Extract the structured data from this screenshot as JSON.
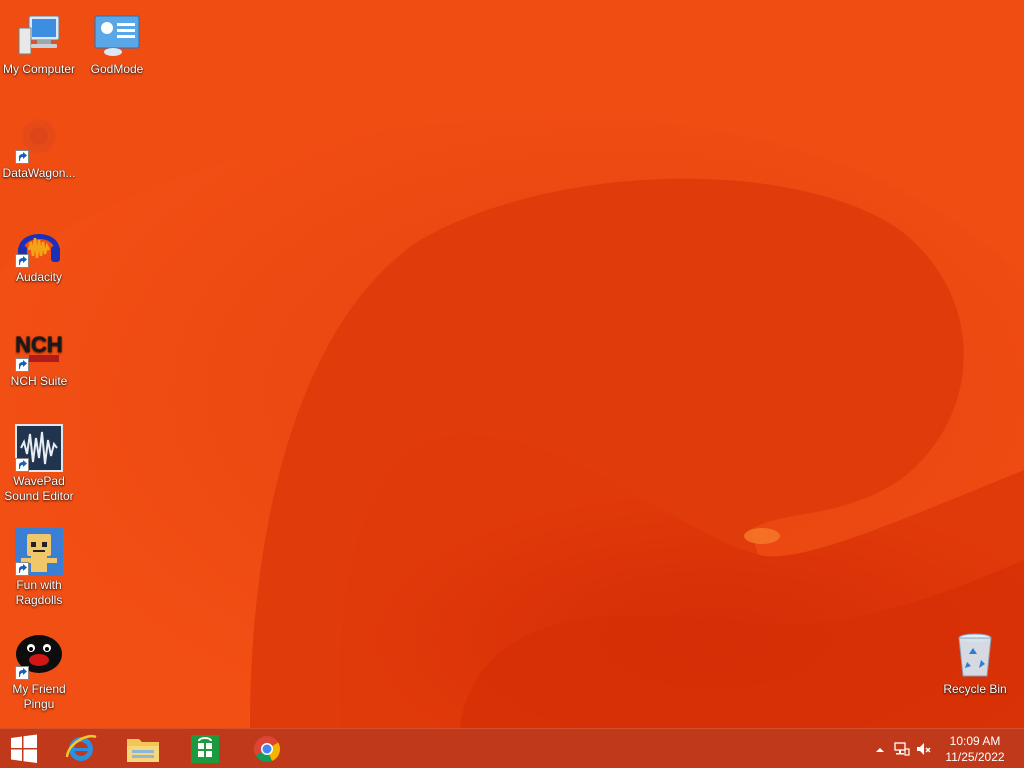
{
  "desktop": {
    "icons": [
      {
        "label": "My Computer",
        "icon": "computer-icon",
        "shortcut": false
      },
      {
        "label": "GodMode",
        "icon": "control-panel-icon",
        "shortcut": false
      },
      {
        "label": "DataWagon...",
        "icon": "datawagon-icon",
        "shortcut": true
      },
      {
        "label": "Audacity",
        "icon": "audacity-icon",
        "shortcut": true
      },
      {
        "label": "NCH Suite",
        "icon": "nch-icon",
        "shortcut": true
      },
      {
        "label": "WavePad Sound Editor",
        "line1": "WavePad",
        "line2": "Sound Editor",
        "icon": "wavepad-icon",
        "shortcut": true
      },
      {
        "label": "Fun with Ragdolls",
        "line1": "Fun with",
        "line2": "Ragdolls",
        "icon": "ragdolls-icon",
        "shortcut": true
      },
      {
        "label": "My Friend Pingu",
        "line1": "My Friend",
        "line2": "Pingu",
        "icon": "pingu-icon",
        "shortcut": true
      },
      {
        "label": "Recycle Bin",
        "icon": "recycle-bin-icon",
        "shortcut": false
      }
    ],
    "wallpaper_color": "#ef4a12"
  },
  "taskbar": {
    "color": "#c0391a",
    "pinned": [
      {
        "name": "start",
        "icon": "windows-logo-icon"
      },
      {
        "name": "internet-explorer",
        "icon": "internet-explorer-icon"
      },
      {
        "name": "file-explorer",
        "icon": "folder-icon"
      },
      {
        "name": "store",
        "icon": "store-icon"
      },
      {
        "name": "chrome",
        "icon": "chrome-icon"
      }
    ],
    "tray": {
      "icons": [
        "show-hidden-icons-icon",
        "network-icon",
        "volume-muted-icon"
      ],
      "time": "10:09 AM",
      "date": "11/25/2022"
    }
  }
}
